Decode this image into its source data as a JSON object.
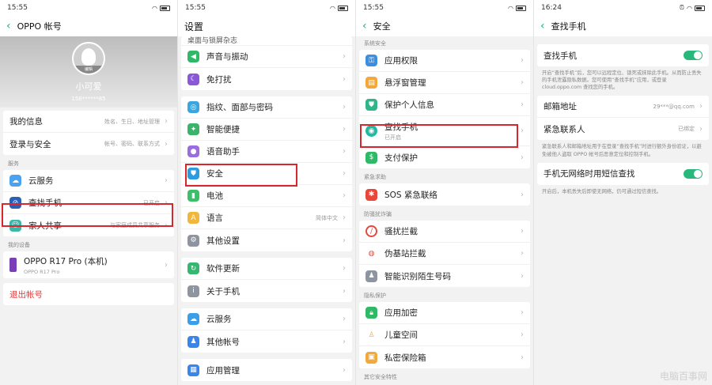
{
  "panel1": {
    "time": "15:55",
    "title": "OPPO 帐号",
    "profile": {
      "edit": "编辑",
      "name": "小可爱",
      "phone": "158******85"
    },
    "rows_top": [
      {
        "label": "我的信息",
        "meta": "姓名、生日、地址管理"
      },
      {
        "label": "登录与安全",
        "meta": "帐号、密码、联系方式"
      }
    ],
    "services_label": "服务",
    "services": [
      {
        "label": "云服务",
        "meta": ""
      },
      {
        "label": "查找手机",
        "meta": "已开启"
      },
      {
        "label": "家人共享",
        "meta": "与家庭成员共享服务"
      }
    ],
    "devices_label": "我的设备",
    "device": {
      "name": "OPPO R17 Pro (本机)",
      "model": "OPPO R17 Pro"
    },
    "logout": "退出帐号"
  },
  "panel2": {
    "time": "15:55",
    "title": "设置",
    "partial": "桌面与锁屏杂志",
    "group1": [
      "声音与振动",
      "免打扰"
    ],
    "group2": [
      "指纹、面部与密码",
      "智能便捷",
      "语音助手",
      "安全",
      "电池",
      "语言",
      "其他设置"
    ],
    "language_value": "简体中文",
    "group3": [
      "软件更新",
      "关于手机"
    ],
    "group4": [
      "云服务",
      "其他帐号"
    ],
    "group5": [
      "应用管理"
    ]
  },
  "panel3": {
    "time": "15:55",
    "title": "安全",
    "sec1_label": "系统安全",
    "sec1": [
      "应用权限",
      "悬浮窗管理",
      "保护个人信息",
      "查找手机",
      "支付保护"
    ],
    "find_status": "已开启",
    "sec2_label": "紧急求助",
    "sec2": [
      "SOS 紧急联络"
    ],
    "sec3_label": "防骚扰诈骗",
    "sec3": [
      "骚扰拦截",
      "伪基站拦截",
      "智能识别陌生号码"
    ],
    "sec4_label": "隐私保护",
    "sec4": [
      "应用加密",
      "儿童空间",
      "私密保险箱"
    ],
    "sec5_label": "其它安全特性"
  },
  "panel4": {
    "time": "16:24",
    "title": "查找手机",
    "find_label": "查找手机",
    "find_note": "开启“查找手机”后，您可以远程定位、锁死或抹除此手机。从而防止丢失的手机泄露隐私数据。您可使用“查找手机”应用，或登录 cloud.oppo.com 查找您的手机。",
    "email_label": "邮箱地址",
    "email_value": "29***@qq.com",
    "contact_label": "紧急联系人",
    "contact_value": "已绑定",
    "contact_note": "紧急联系人和邮箱地址用于在登录“查找手机”时进行额外身份验证，以避免被他人盗取 OPPO 帐号后恶意定位和控制手机。",
    "sms_label": "手机无网络时用短信查找",
    "sms_note": "开启后，本机丢失后即使无网络，仍可通过短信查找。",
    "watermark": "电脑百事网"
  },
  "colors": {
    "accent": "#18b58a",
    "highlight": "#d7262e",
    "logout": "#e23a3a"
  },
  "chevron": "›"
}
